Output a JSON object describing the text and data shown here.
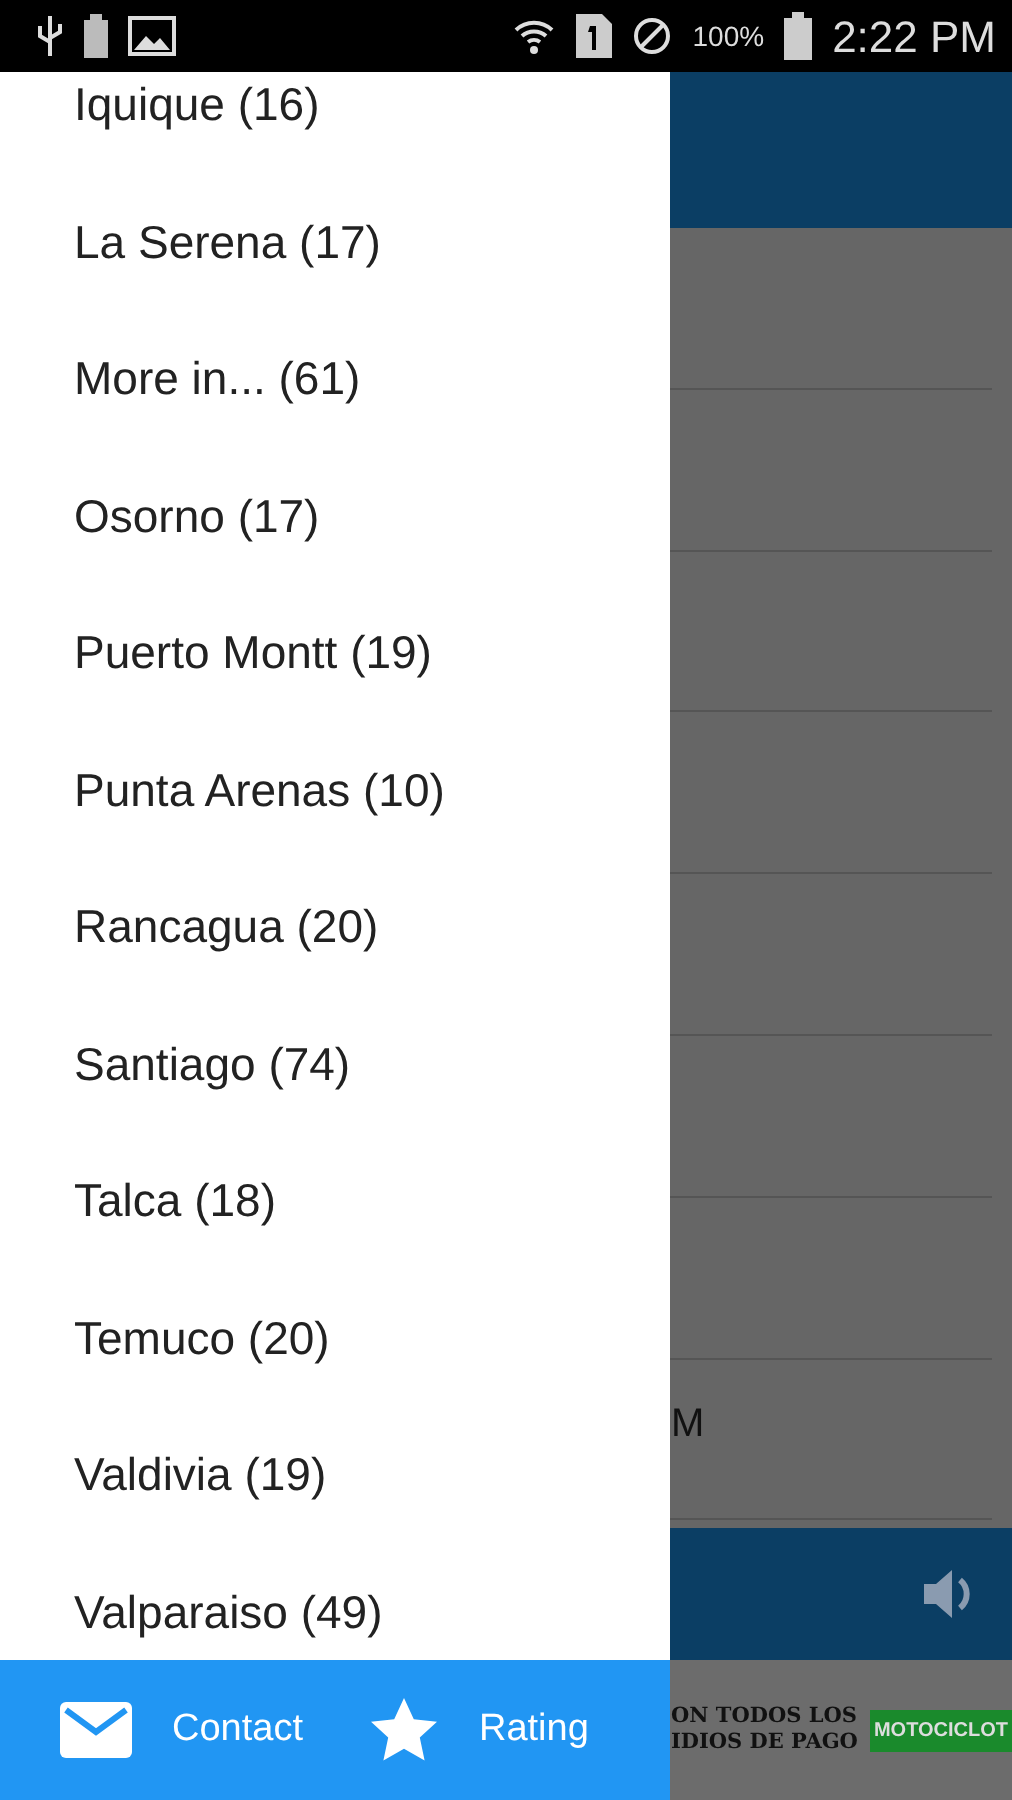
{
  "status_bar": {
    "battery_percent": "100%",
    "time": "2:22 PM"
  },
  "drawer": {
    "items": [
      {
        "label": "Iquique (16)"
      },
      {
        "label": "La Serena (17)"
      },
      {
        "label": "More in... (61)"
      },
      {
        "label": "Osorno (17)"
      },
      {
        "label": "Puerto Montt (19)"
      },
      {
        "label": "Punta Arenas (10)"
      },
      {
        "label": "Rancagua (20)"
      },
      {
        "label": "Santiago (74)"
      },
      {
        "label": "Talca (18)"
      },
      {
        "label": "Temuco (20)"
      },
      {
        "label": "Valdivia (19)"
      },
      {
        "label": "Valparaiso (49)"
      }
    ],
    "footer": [
      {
        "kind": "mail",
        "label": "Contact"
      },
      {
        "kind": "star",
        "label": "Rating"
      }
    ]
  },
  "background": {
    "row_fragment": "M",
    "ad": {
      "lines": [
        "ON TODOS LOS",
        "IDIOS DE PAGO"
      ],
      "tag": "MOTOCICLOT"
    }
  }
}
